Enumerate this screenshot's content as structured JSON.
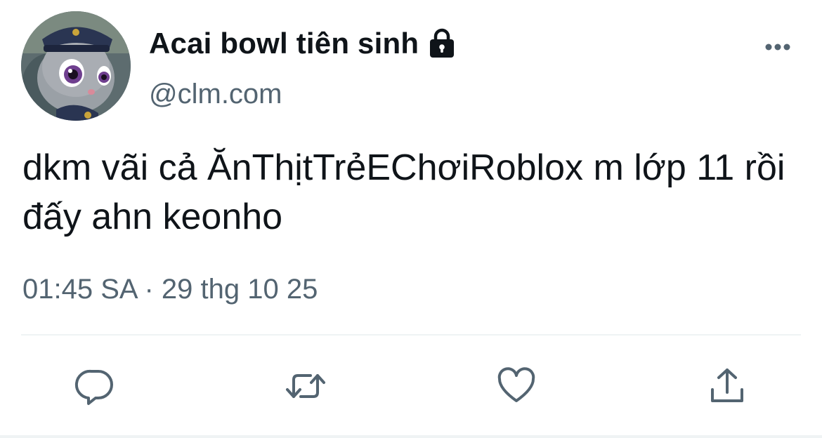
{
  "author": {
    "display_name": "Acai bowl tiên sinh",
    "handle": "@clm.com",
    "protected": true,
    "avatar_icon": "judy-hopps-police-avatar"
  },
  "tweet": {
    "text": "dkm vãi cả ĂnThịtTrẻEChơiRoblox m lớp 11 rồi đấy ahn keonho",
    "timestamp": "01:45 SA · 29 thg 10 25"
  },
  "actions": {
    "reply_icon": "reply-icon",
    "retweet_icon": "retweet-icon",
    "like_icon": "heart-icon",
    "share_icon": "share-icon"
  },
  "colors": {
    "text_primary": "#0f1419",
    "text_secondary": "#536471",
    "icon_gray": "#536471",
    "divider": "#eff3f4"
  }
}
